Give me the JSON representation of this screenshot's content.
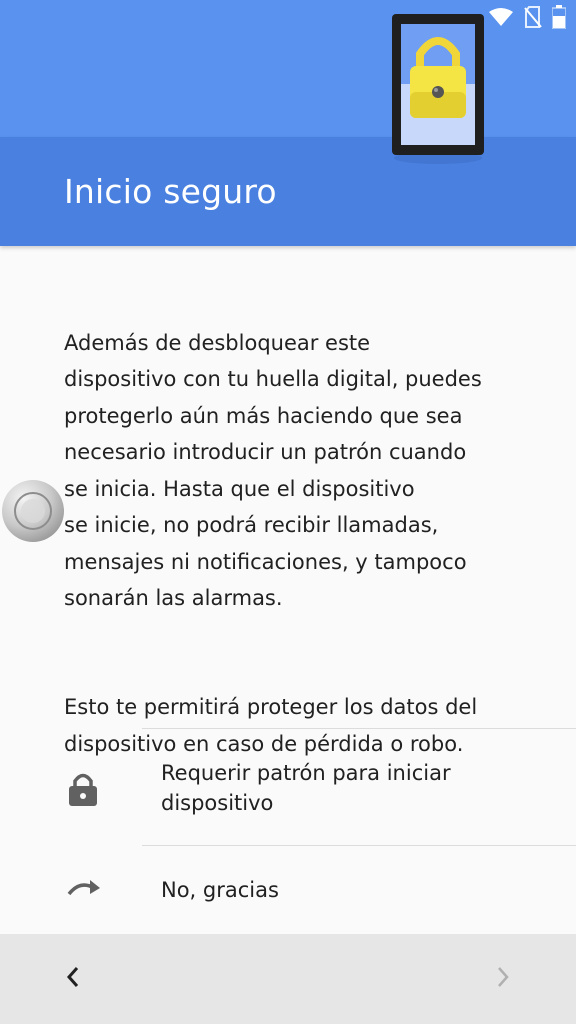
{
  "status_bar": {
    "icons": [
      "wifi-icon",
      "no-sim-icon",
      "battery-icon"
    ]
  },
  "header": {
    "title": "Inicio seguro",
    "illustration": "phone-padlock-illustration",
    "colors": {
      "top": "#5993ef",
      "bottom": "#4a80e0"
    }
  },
  "body": {
    "paragraph1": "Además de desbloquear este\ndispositivo con tu huella digital, puedes\nprotegerlo aún más haciendo que sea\nnecesario introducir un patrón cuando\nse inicia. Hasta que el dispositivo\nse inicie, no podrá recibir llamadas,\nmensajes ni notificaciones, y tampoco\nsonarán las alarmas.",
    "paragraph2": "Esto te permitirá proteger los datos del\ndispositivo en caso de pérdida o robo."
  },
  "options": [
    {
      "label": "Requerir patrón para iniciar dispositivo",
      "icon": "lock-icon"
    },
    {
      "label": "No, gracias",
      "icon": "skip-arrow-icon"
    }
  ],
  "bottom_nav": {
    "back_icon": "chevron-left-icon",
    "next_icon": "chevron-right-icon",
    "next_enabled": false
  },
  "floating": {
    "icon": "assistive-touch-icon"
  }
}
